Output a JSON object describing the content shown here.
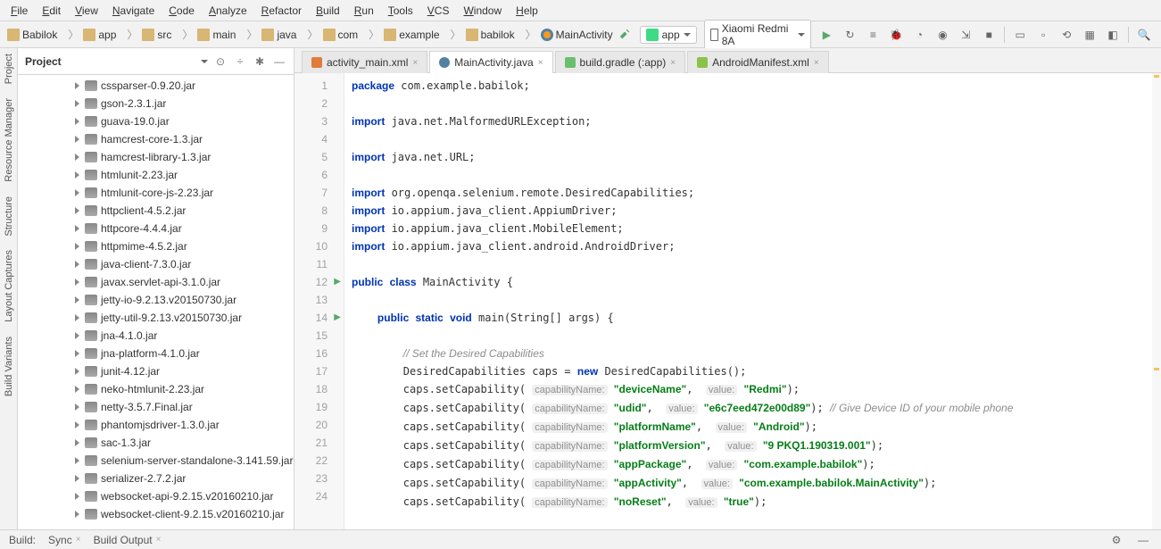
{
  "menu": [
    "File",
    "Edit",
    "View",
    "Navigate",
    "Code",
    "Analyze",
    "Refactor",
    "Build",
    "Run",
    "Tools",
    "VCS",
    "Window",
    "Help"
  ],
  "breadcrumb": [
    "Babilok",
    "app",
    "src",
    "main",
    "java",
    "com",
    "example",
    "babilok",
    "MainActivity"
  ],
  "run_config": "app",
  "device": "Xiaomi Redmi 8A",
  "project_label": "Project",
  "side_tabs": [
    "Project",
    "Resource Manager",
    "Structure",
    "Layout Captures",
    "Build Variants"
  ],
  "jars": [
    "cssparser-0.9.20.jar",
    "gson-2.3.1.jar",
    "guava-19.0.jar",
    "hamcrest-core-1.3.jar",
    "hamcrest-library-1.3.jar",
    "htmlunit-2.23.jar",
    "htmlunit-core-js-2.23.jar",
    "httpclient-4.5.2.jar",
    "httpcore-4.4.4.jar",
    "httpmime-4.5.2.jar",
    "java-client-7.3.0.jar",
    "javax.servlet-api-3.1.0.jar",
    "jetty-io-9.2.13.v20150730.jar",
    "jetty-util-9.2.13.v20150730.jar",
    "jna-4.1.0.jar",
    "jna-platform-4.1.0.jar",
    "junit-4.12.jar",
    "neko-htmlunit-2.23.jar",
    "netty-3.5.7.Final.jar",
    "phantomjsdriver-1.3.0.jar",
    "sac-1.3.jar",
    "selenium-server-standalone-3.141.59.jar",
    "serializer-2.7.2.jar",
    "websocket-api-9.2.15.v20160210.jar",
    "websocket-client-9.2.15.v20160210.jar"
  ],
  "tabs": [
    {
      "label": "activity_main.xml",
      "type": "xml"
    },
    {
      "label": "MainActivity.java",
      "type": "java",
      "active": true
    },
    {
      "label": "build.gradle (:app)",
      "type": "gradle"
    },
    {
      "label": "AndroidManifest.xml",
      "type": "manifest"
    }
  ],
  "code": {
    "package": "com.example.babilok",
    "imports": [
      "java.net.MalformedURLException",
      "java.net.URL",
      "org.openqa.selenium.remote.DesiredCapabilities",
      "io.appium.java_client.AppiumDriver",
      "io.appium.java_client.MobileElement",
      "io.appium.java_client.android.AndroidDriver"
    ],
    "class_name": "MainActivity",
    "method_sig": "main(String[] args)",
    "comment1": "// Set the Desired Capabilities",
    "init": "DesiredCapabilities caps = ",
    "new_expr": "DesiredCapabilities();",
    "caps": [
      {
        "name": "deviceName",
        "value": "Redmi",
        "comment": ""
      },
      {
        "name": "udid",
        "value": "e6c7eed472e00d89",
        "comment": "// Give Device ID of your mobile phone"
      },
      {
        "name": "platformName",
        "value": "Android",
        "comment": ""
      },
      {
        "name": "platformVersion",
        "value": "9 PKQ1.190319.001",
        "comment": ""
      },
      {
        "name": "appPackage",
        "value": "com.example.babilok",
        "comment": ""
      },
      {
        "name": "appActivity",
        "value": "com.example.babilok.MainActivity",
        "comment": ""
      },
      {
        "name": "noReset",
        "value": "true",
        "comment": ""
      }
    ],
    "hint_name": "capabilityName:",
    "hint_value": "value:"
  },
  "bottom": {
    "build": "Build:",
    "sync": "Sync",
    "output": "Build Output"
  }
}
